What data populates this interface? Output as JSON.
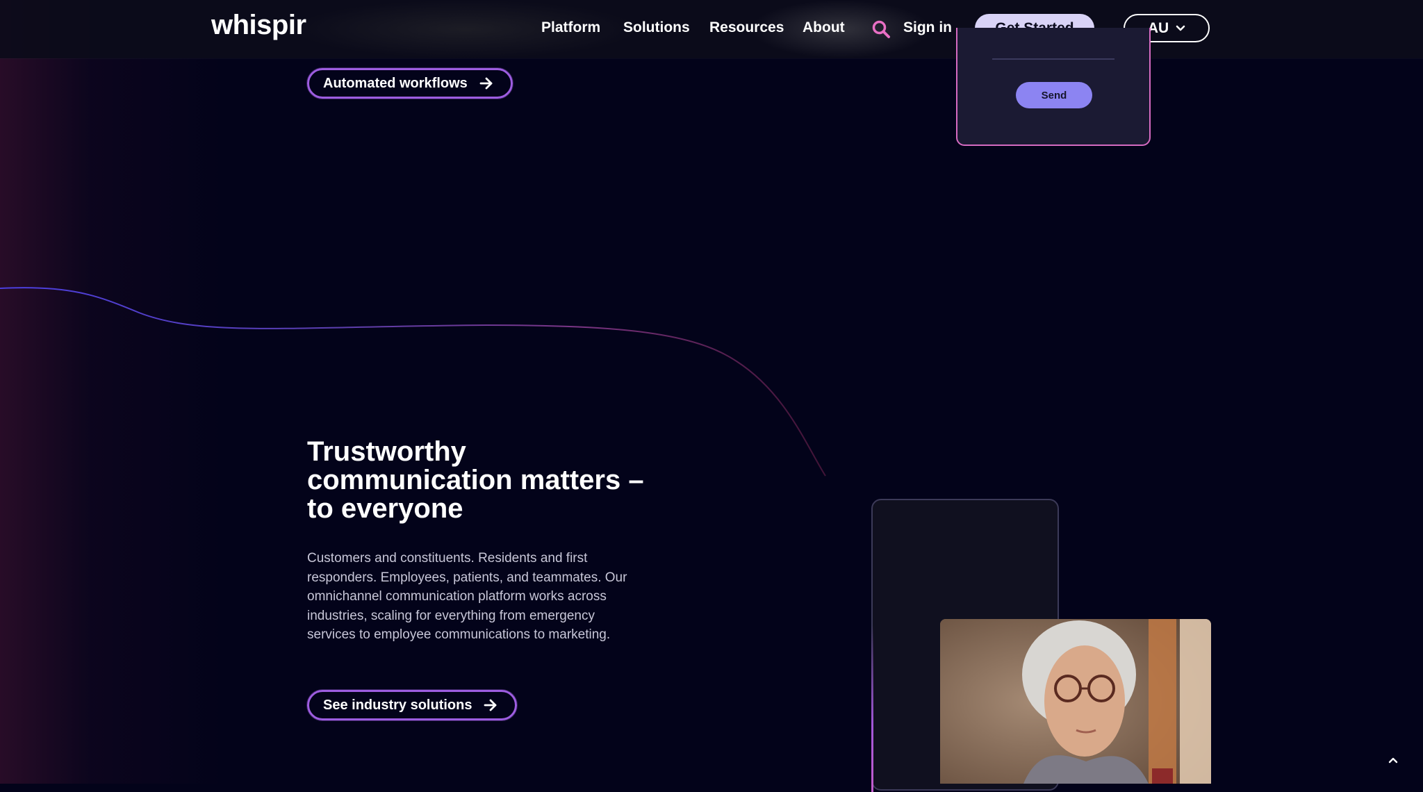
{
  "header": {
    "logo": "whispir",
    "nav": [
      {
        "label": "Platform"
      },
      {
        "label": "Solutions"
      },
      {
        "label": "Resources"
      },
      {
        "label": "About"
      }
    ],
    "sign_in": "Sign in",
    "cta": "Get Started",
    "region": "AU"
  },
  "top_section": {
    "button_label": "Automated workflows",
    "form_send": "Send"
  },
  "trust_section": {
    "headline": "Trustworthy communication matters – to everyone",
    "body": "Customers and constituents. Residents and first responders. Employees, patients, and teammates. Our omnichannel communication platform works across industries, scaling for everything from emergency services to employee communications to marketing.",
    "button_label": "See industry solutions"
  },
  "colors": {
    "background": "#03031a",
    "accent_purple": "#9d5de0",
    "accent_pink": "#d66bc2",
    "cta_bg": "#d9d3f7",
    "send_bg": "#8c84f2"
  },
  "icons": {
    "search": "search-icon",
    "chevron": "chevron-down-icon",
    "arrow": "arrow-right-icon",
    "scroll_top": "chevron-up-icon"
  }
}
